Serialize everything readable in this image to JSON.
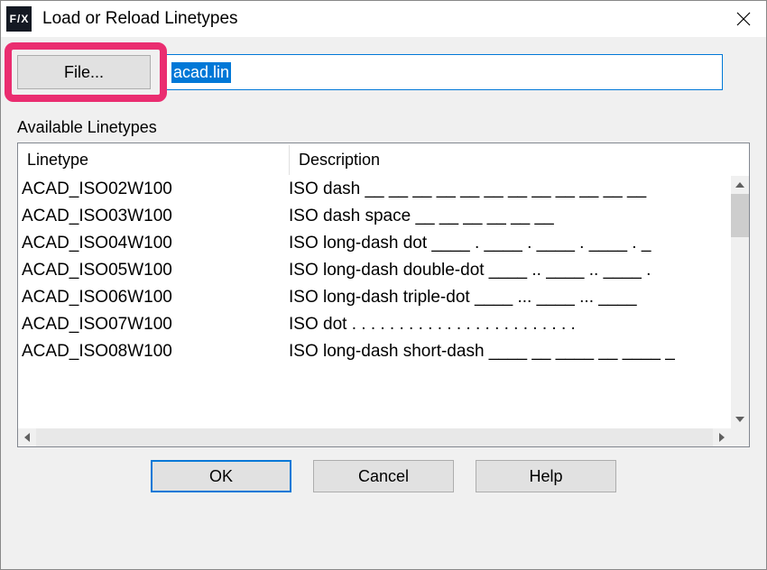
{
  "window": {
    "title": "Load or Reload Linetypes",
    "app_icon_text": "F/X"
  },
  "file": {
    "button_label": "File...",
    "input_value": "acad.lin"
  },
  "section": {
    "label": "Available Linetypes",
    "columns": {
      "linetype": "Linetype",
      "description": "Description"
    },
    "rows": [
      {
        "name": "ACAD_ISO02W100",
        "desc": "ISO dash __ __ __ __ __ __ __ __ __ __ __ __"
      },
      {
        "name": "ACAD_ISO03W100",
        "desc": "ISO dash space __    __    __    __    __    __"
      },
      {
        "name": "ACAD_ISO04W100",
        "desc": "ISO long-dash dot ____ . ____ . ____ . ____ . _"
      },
      {
        "name": "ACAD_ISO05W100",
        "desc": "ISO long-dash double-dot ____ .. ____ .. ____ ."
      },
      {
        "name": "ACAD_ISO06W100",
        "desc": "ISO long-dash triple-dot ____ ... ____ ... ____"
      },
      {
        "name": "ACAD_ISO07W100",
        "desc": "ISO dot . . . . . . . . . . . . . . . . . . . . . . . ."
      },
      {
        "name": "ACAD_ISO08W100",
        "desc": "ISO long-dash short-dash ____ __ ____ __ ____ _"
      }
    ]
  },
  "buttons": {
    "ok": "OK",
    "cancel": "Cancel",
    "help": "Help"
  }
}
